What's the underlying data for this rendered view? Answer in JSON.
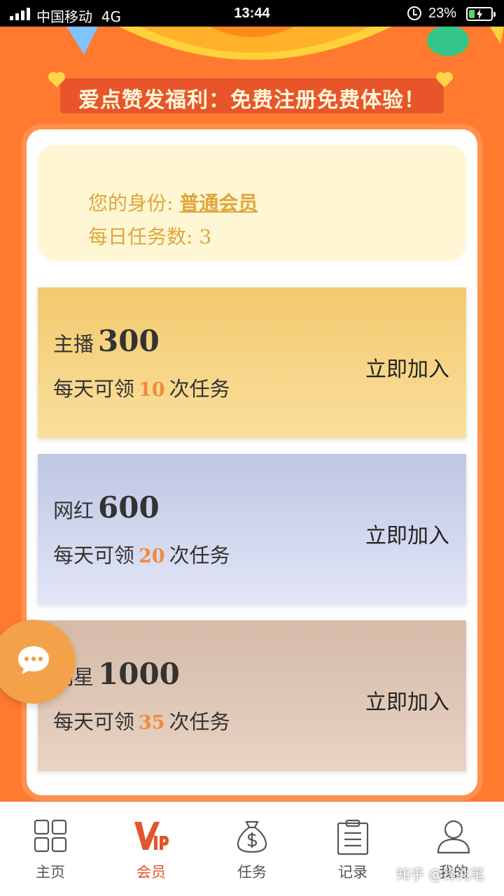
{
  "status_bar": {
    "carrier": "中国移动",
    "network": "4G",
    "time": "13:44",
    "battery": "23%"
  },
  "banner": {
    "title": "爱点赞发福利：免费注册免费体验！"
  },
  "member": {
    "identity_label": "您的身份:",
    "identity_value": "普通会员",
    "tasks_label": "每日任务数:",
    "tasks_value": "3"
  },
  "plans": [
    {
      "name": "主播",
      "price": "300",
      "desc_prefix": "每天可领",
      "count": "10",
      "desc_suffix": "次任务",
      "join_label": "立即加入"
    },
    {
      "name": "网红",
      "price": "600",
      "desc_prefix": "每天可领",
      "count": "20",
      "desc_suffix": "次任务",
      "join_label": "立即加入"
    },
    {
      "name": "明星",
      "price": "1000",
      "desc_prefix": "每天可领",
      "count": "35",
      "desc_suffix": "次任务",
      "join_label": "立即加入"
    }
  ],
  "tabs": [
    {
      "label": "主页",
      "icon": "grid-icon"
    },
    {
      "label": "会员",
      "icon": "vip-icon"
    },
    {
      "label": "任务",
      "icon": "money-bag-icon"
    },
    {
      "label": "记录",
      "icon": "clipboard-icon"
    },
    {
      "label": "我的",
      "icon": "person-icon"
    }
  ],
  "active_tab": "会员",
  "watermark": "知乎 @锋兆笔",
  "colors": {
    "brand_orange": "#ff7a2e",
    "active_tab": "#e2552d",
    "member_text": "#e0a63a",
    "count_text": "#f08a3e"
  }
}
